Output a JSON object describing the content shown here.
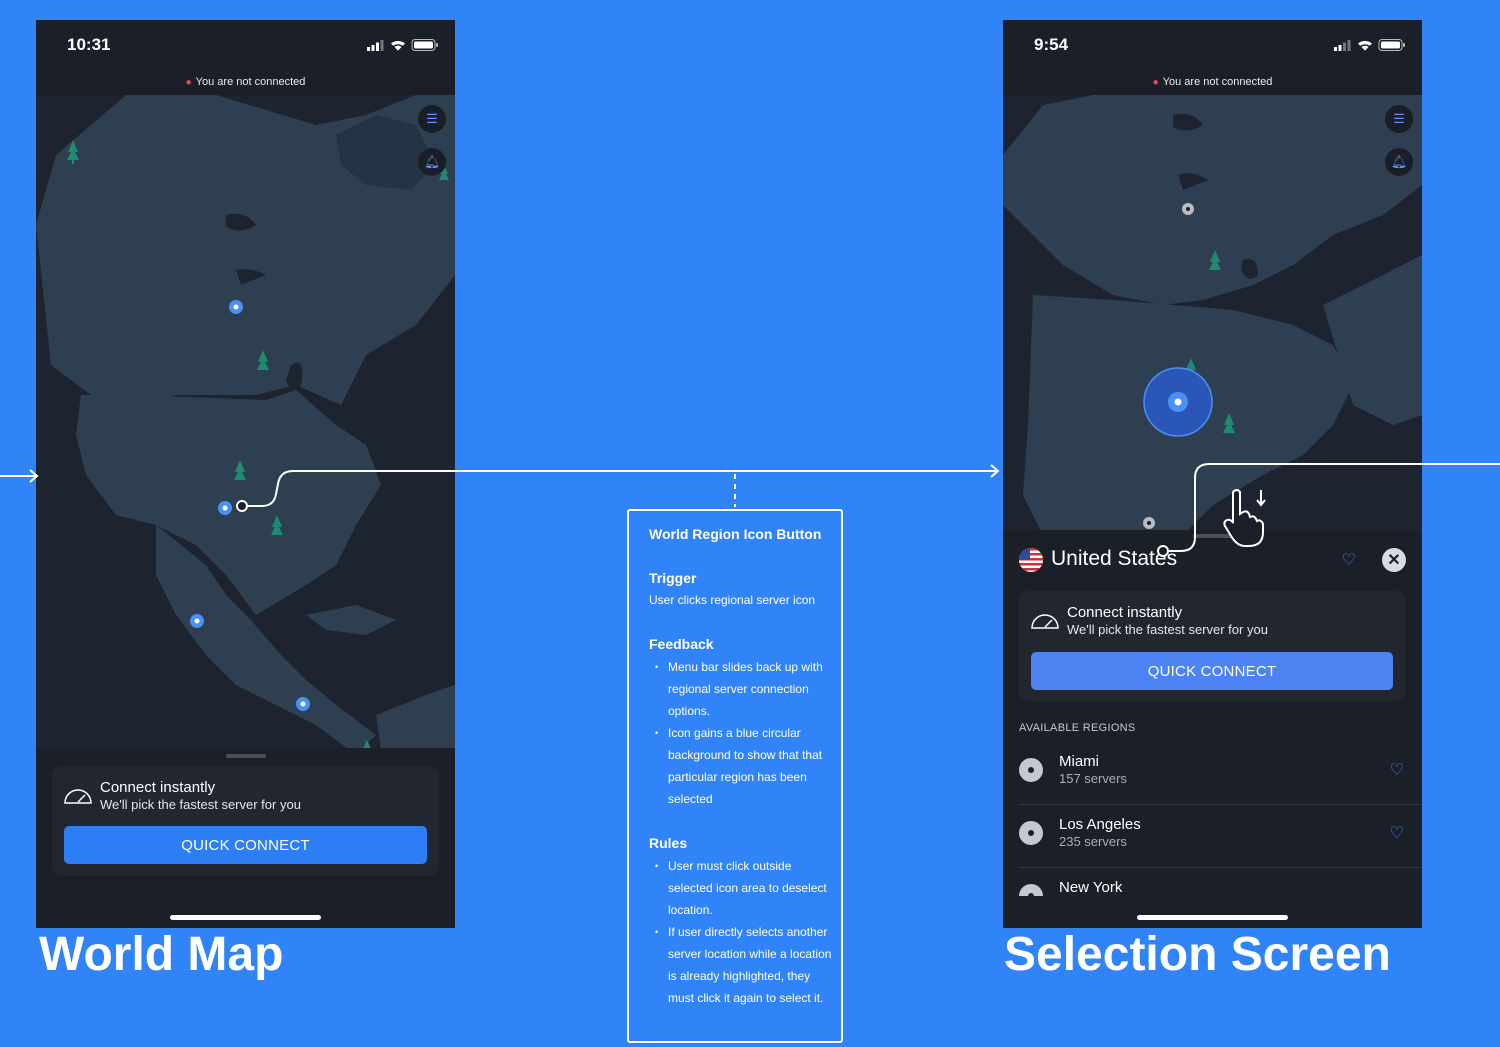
{
  "colors": {
    "background": "#3184f8",
    "phone": "#1b1f28",
    "map_land": "#2e3f52",
    "accent": "#3a7cf6",
    "pin": "#4a90f5",
    "tree": "#1f8a72"
  },
  "left_screen": {
    "time": "10:31",
    "status_text": "You are not connected",
    "icons": [
      "settings-sliders-icon",
      "notification-bell-icon"
    ],
    "connect_card": {
      "title": "Connect instantly",
      "subtitle": "We'll pick the fastest server for you",
      "button": "QUICK CONNECT"
    },
    "label": "World Map"
  },
  "right_screen": {
    "time": "9:54",
    "status_text": "You are not connected",
    "icons": [
      "settings-sliders-icon",
      "notification-bell-icon"
    ],
    "country": {
      "name": "United States",
      "flag": "us-flag-icon"
    },
    "connect_card": {
      "title": "Connect instantly",
      "subtitle": "We'll pick the fastest server for you",
      "button": "QUICK CONNECT"
    },
    "available_regions_label": "AVAILABLE REGIONS",
    "regions": [
      {
        "name": "Miami",
        "servers": "157 servers"
      },
      {
        "name": "Los Angeles",
        "servers": "235 servers"
      },
      {
        "name": "New York",
        "servers": ""
      }
    ],
    "label": "Selection Screen"
  },
  "note": {
    "title": "World Region Icon Button",
    "trigger": {
      "heading": "Trigger",
      "text": "User clicks regional server icon"
    },
    "feedback": {
      "heading": "Feedback",
      "items": [
        "Menu bar slides back up with regional server connection options.",
        "Icon gains a blue circular background to show that that particular region has been selected"
      ]
    },
    "rules": {
      "heading": "Rules",
      "items": [
        "User must click outside selected icon area to deselect location.",
        "If user directly selects another server location while a location is already highlighted, they must click it again to select it."
      ]
    }
  }
}
